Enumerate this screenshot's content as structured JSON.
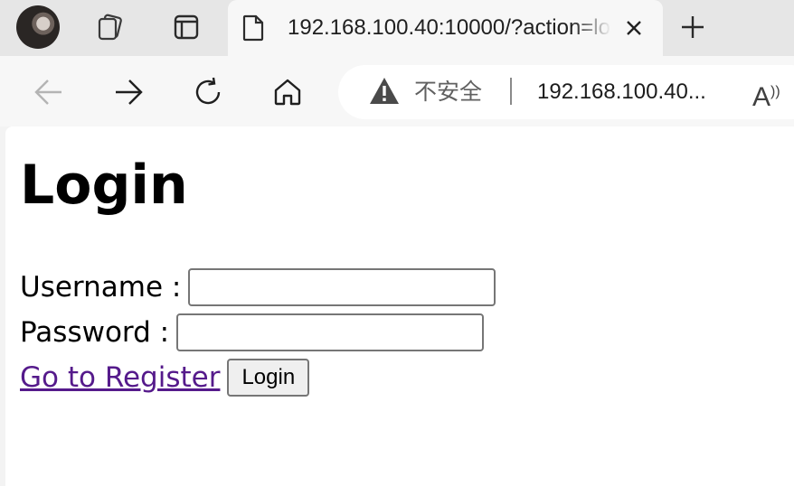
{
  "browser": {
    "tab": {
      "title": "192.168.100.40:10000/?action=login"
    },
    "address_bar": {
      "security_label": "不安全",
      "url": "192.168.100.40..."
    },
    "read_aloud_glyph": "A",
    "icons": {
      "profile": "avatar",
      "workspaces": "workspaces-icon",
      "vertical_tabs": "tab-actions-icon",
      "page": "page-icon",
      "close": "close-icon",
      "new_tab": "plus-icon",
      "back": "back-arrow-icon",
      "forward": "forward-arrow-icon",
      "refresh": "refresh-icon",
      "home": "home-icon",
      "warning": "warning-icon",
      "read_aloud": "read-aloud-icon"
    }
  },
  "page": {
    "heading": "Login",
    "username_label": "Username :",
    "username_value": "",
    "password_label": "Password :",
    "password_value": "",
    "register_link": "Go to Register",
    "login_button": "Login"
  },
  "colors": {
    "link_visited": "#551a8b",
    "tabstrip_bg": "#e6e6e6",
    "toolbar_bg": "#f7f7f7"
  }
}
